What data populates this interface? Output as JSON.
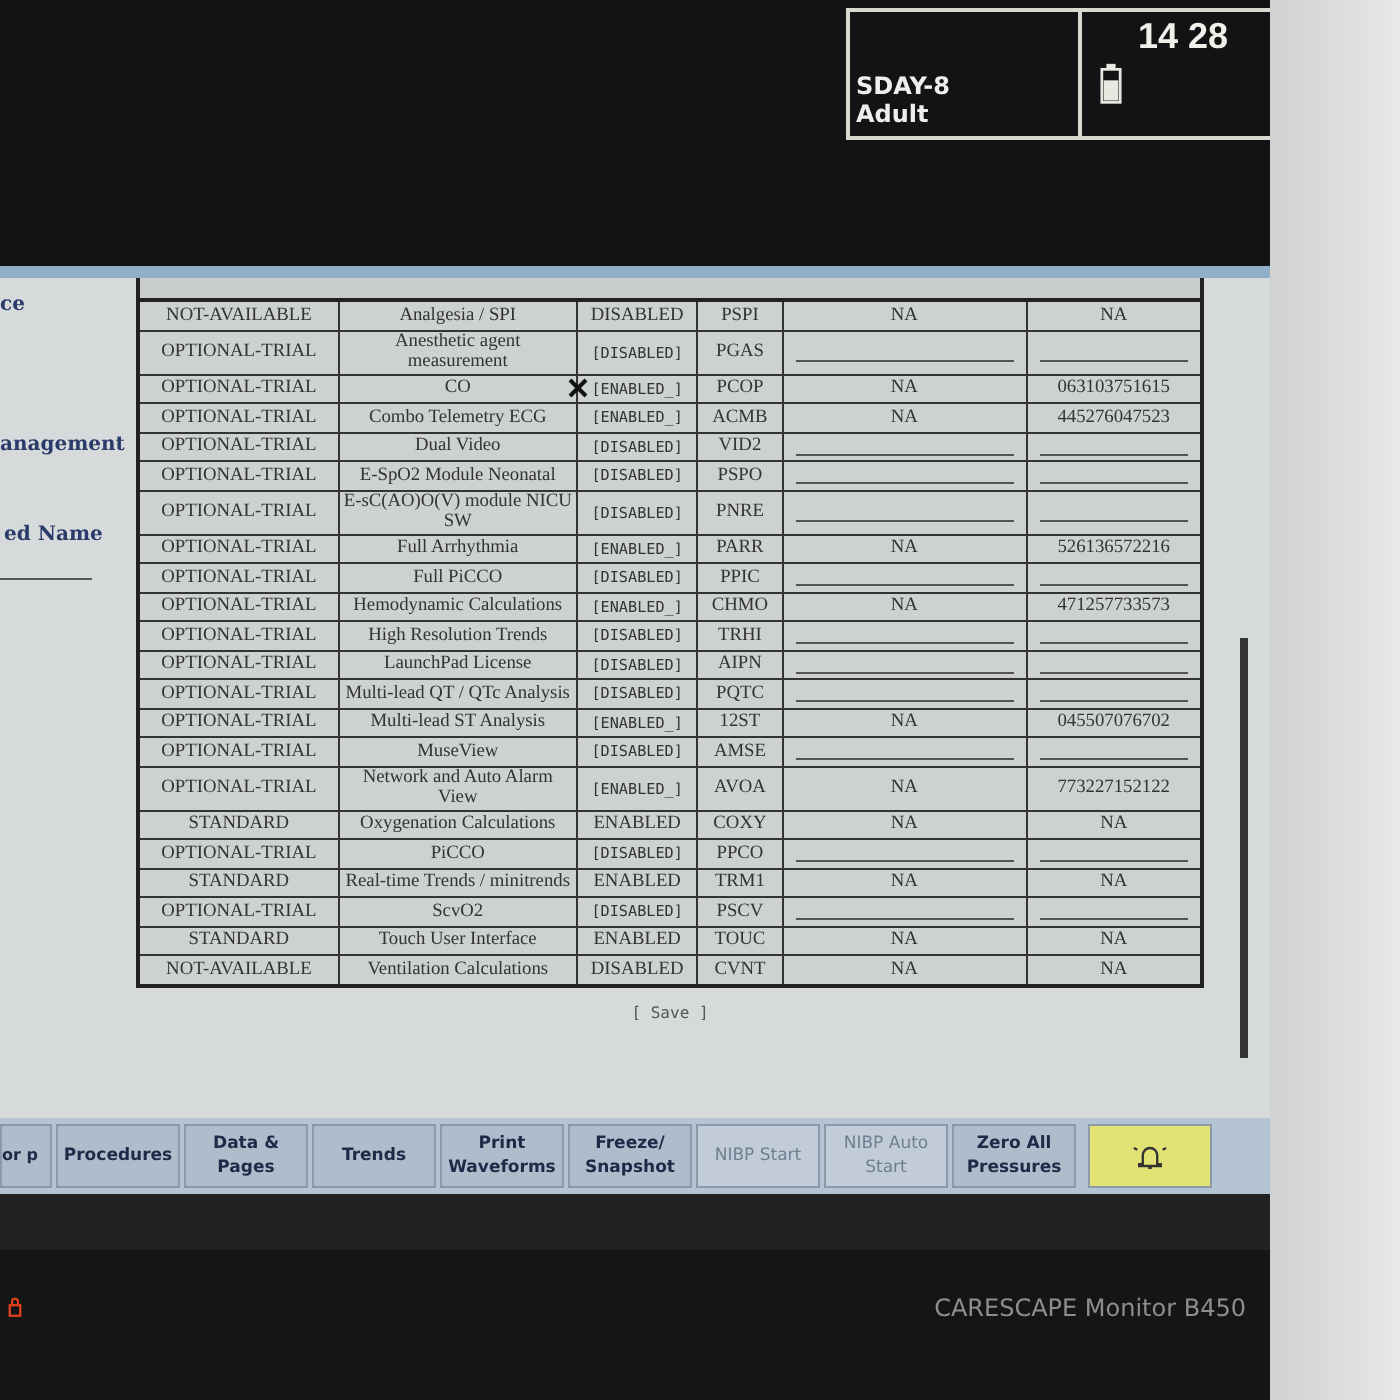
{
  "patient": {
    "bed": "SDAY-8",
    "category": "Adult",
    "time": "14 28"
  },
  "side_labels": [
    "ce",
    "anagement",
    "ed Name"
  ],
  "table": {
    "rows": [
      {
        "category": "NOT-AVAILABLE",
        "option": "Analgesia / SPI",
        "status": "DISABLED",
        "kind": "fixed",
        "code": "PSPI",
        "column_5": "NA",
        "column_6": "NA"
      },
      {
        "category": "OPTIONAL-TRIAL",
        "option": "Anesthetic agent measurement",
        "status": "[DISABLED]",
        "kind": "toggle",
        "code": "PGAS"
      },
      {
        "category": "OPTIONAL-TRIAL",
        "option": "CO",
        "status": "[ENABLED_]",
        "kind": "toggle",
        "code": "PCOP",
        "column_5": "NA",
        "column_6": "063103751615",
        "cursor": true
      },
      {
        "category": "OPTIONAL-TRIAL",
        "option": "Combo Telemetry ECG",
        "status": "[ENABLED_]",
        "kind": "toggle",
        "code": "ACMB",
        "column_5": "NA",
        "column_6": "445276047523"
      },
      {
        "category": "OPTIONAL-TRIAL",
        "option": "Dual Video",
        "status": "[DISABLED]",
        "kind": "toggle",
        "code": "VID2"
      },
      {
        "category": "OPTIONAL-TRIAL",
        "option": "E-SpO2 Module Neonatal",
        "status": "[DISABLED]",
        "kind": "toggle",
        "code": "PSPO"
      },
      {
        "category": "OPTIONAL-TRIAL",
        "option": "E-sC(AO)O(V) module NICU SW",
        "status": "[DISABLED]",
        "kind": "toggle",
        "code": "PNRE"
      },
      {
        "category": "OPTIONAL-TRIAL",
        "option": "Full Arrhythmia",
        "status": "[ENABLED_]",
        "kind": "toggle",
        "code": "PARR",
        "column_5": "NA",
        "column_6": "526136572216"
      },
      {
        "category": "OPTIONAL-TRIAL",
        "option": "Full PiCCO",
        "status": "[DISABLED]",
        "kind": "toggle",
        "code": "PPIC"
      },
      {
        "category": "OPTIONAL-TRIAL",
        "option": "Hemodynamic Calculations",
        "status": "[ENABLED_]",
        "kind": "toggle",
        "code": "CHMO",
        "column_5": "NA",
        "column_6": "471257733573"
      },
      {
        "category": "OPTIONAL-TRIAL",
        "option": "High Resolution Trends",
        "status": "[DISABLED]",
        "kind": "toggle",
        "code": "TRHI"
      },
      {
        "category": "OPTIONAL-TRIAL",
        "option": "LaunchPad License",
        "status": "[DISABLED]",
        "kind": "toggle",
        "code": "AIPN"
      },
      {
        "category": "OPTIONAL-TRIAL",
        "option": "Multi-lead QT / QTc Analysis",
        "status": "[DISABLED]",
        "kind": "toggle",
        "code": "PQTC"
      },
      {
        "category": "OPTIONAL-TRIAL",
        "option": "Multi-lead ST Analysis",
        "status": "[ENABLED_]",
        "kind": "toggle",
        "code": "12ST",
        "column_5": "NA",
        "column_6": "045507076702"
      },
      {
        "category": "OPTIONAL-TRIAL",
        "option": "MuseView",
        "status": "[DISABLED]",
        "kind": "toggle",
        "code": "AMSE"
      },
      {
        "category": "OPTIONAL-TRIAL",
        "option": "Network and Auto Alarm View",
        "status": "[ENABLED_]",
        "kind": "toggle",
        "code": "AVOA",
        "column_5": "NA",
        "column_6": "773227152122"
      },
      {
        "category": "STANDARD",
        "option": "Oxygenation Calculations",
        "status": "ENABLED",
        "kind": "fixed",
        "code": "COXY",
        "column_5": "NA",
        "column_6": "NA"
      },
      {
        "category": "OPTIONAL-TRIAL",
        "option": "PiCCO",
        "status": "[DISABLED]",
        "kind": "toggle",
        "code": "PPCO"
      },
      {
        "category": "STANDARD",
        "option": "Real-time Trends / minitrends",
        "status": "ENABLED",
        "kind": "fixed",
        "code": "TRM1",
        "column_5": "NA",
        "column_6": "NA"
      },
      {
        "category": "OPTIONAL-TRIAL",
        "option": "ScvO2",
        "status": "[DISABLED]",
        "kind": "toggle",
        "code": "PSCV"
      },
      {
        "category": "STANDARD",
        "option": "Touch User Interface",
        "status": "ENABLED",
        "kind": "fixed",
        "code": "TOUC",
        "column_5": "NA",
        "column_6": "NA"
      },
      {
        "category": "NOT-AVAILABLE",
        "option": "Ventilation Calculations",
        "status": "DISABLED",
        "kind": "fixed",
        "code": "CVNT",
        "column_5": "NA",
        "column_6": "NA"
      }
    ]
  },
  "save": "[ Save ]",
  "buttons": [
    {
      "label": "or p",
      "kind": "text",
      "disabled": false
    },
    {
      "label": "Procedures",
      "kind": "text",
      "disabled": false
    },
    {
      "label": "Data & Pages",
      "kind": "text",
      "disabled": false
    },
    {
      "label": "Trends",
      "kind": "text",
      "disabled": false
    },
    {
      "label": "Print Waveforms",
      "kind": "text",
      "disabled": false
    },
    {
      "label": "Freeze/ Snapshot",
      "kind": "text",
      "disabled": false
    },
    {
      "label": "NIBP Start",
      "kind": "text",
      "disabled": true
    },
    {
      "label": "NIBP Auto Start",
      "kind": "text",
      "disabled": true
    },
    {
      "label": "Zero All Pressures",
      "kind": "text",
      "disabled": false
    },
    {
      "kind": "alarm"
    }
  ],
  "model": "CARESCAPE Monitor B450"
}
